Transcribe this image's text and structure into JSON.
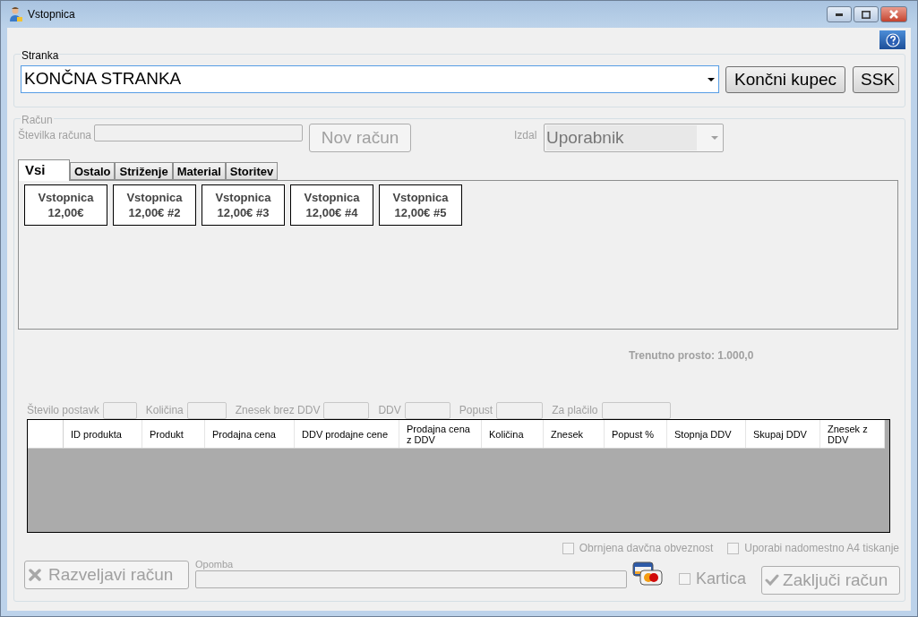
{
  "window": {
    "title": "Vstopnica"
  },
  "customer": {
    "label": "Stranka",
    "value": "KONČNA STRANKA",
    "buttons": [
      {
        "label": "Končni kupec",
        "disabled": false
      },
      {
        "label": "SSK",
        "disabled": false
      }
    ]
  },
  "invoice": {
    "label": "Račun",
    "number_label": "Številka računa",
    "new_button": {
      "label": "Nov račun",
      "disabled": true
    },
    "issuer_label": "Izdal",
    "issuer_value": "Uporabnik"
  },
  "tabs": [
    {
      "label": "Vsi",
      "selected": true
    },
    {
      "label": "Ostalo",
      "selected": false
    },
    {
      "label": "Striženje",
      "selected": false
    },
    {
      "label": "Material",
      "selected": false
    },
    {
      "label": "Storitev",
      "selected": false
    }
  ],
  "products": [
    {
      "name": "Vstopnica",
      "price": "12,00€"
    },
    {
      "name": "Vstopnica",
      "price": "12,00€ #2"
    },
    {
      "name": "Vstopnica",
      "price": "12,00€ #3"
    },
    {
      "name": "Vstopnica",
      "price": "12,00€ #4"
    },
    {
      "name": "Vstopnica",
      "price": "12,00€ #5"
    }
  ],
  "free_capacity": "Trenutno prosto: 1.000,0",
  "summary": [
    "Število postavk",
    "Količina",
    "Znesek brez DDV",
    "DDV",
    "Popust",
    "Za plačilo"
  ],
  "table": {
    "columns": [
      "ID produkta",
      "Produkt",
      "Prodajna cena",
      "DDV prodajne cene",
      "Prodajna cena z DDV",
      "Količina",
      "Znesek",
      "Popust %",
      "Stopnja DDV",
      "Skupaj DDV",
      "Znesek z DDV"
    ]
  },
  "options": [
    {
      "label": "Obrnjena davčna obveznost",
      "checked": false,
      "disabled": true
    },
    {
      "label": "Uporabi nadomestno A4 tiskanje",
      "checked": false,
      "disabled": true
    }
  ],
  "cancel_button": {
    "label": "Razveljavi račun",
    "disabled": true
  },
  "note": {
    "label": "Opomba"
  },
  "card": {
    "label": "Kartica",
    "checked": false,
    "disabled": true
  },
  "finish_button": {
    "label": "Zaključi račun",
    "disabled": true
  }
}
